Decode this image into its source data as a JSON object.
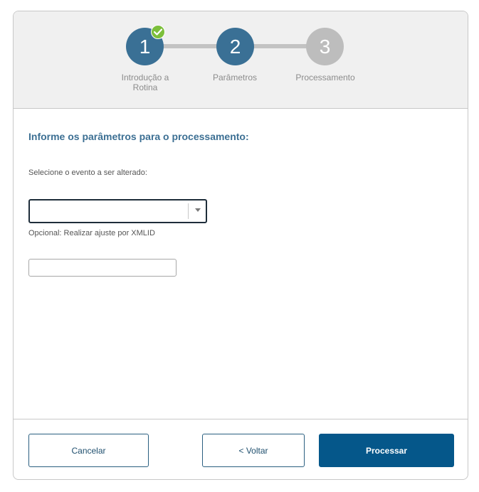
{
  "stepper": {
    "steps": [
      {
        "number": "1",
        "label_line1": "Introdução a",
        "label_line2": "Rotina",
        "status": "done"
      },
      {
        "number": "2",
        "label_line1": "Parâmetros",
        "label_line2": "",
        "status": "active"
      },
      {
        "number": "3",
        "label_line1": "Processamento",
        "label_line2": "",
        "status": "pending"
      }
    ]
  },
  "form": {
    "title": "Informe os parâmetros para o processamento:",
    "event_label": "Selecione o evento a ser alterado:",
    "event_selected_value": "",
    "xmlid_label": "Opcional: Realizar ajuste por XMLID",
    "xmlid_value": "",
    "xmlid_placeholder": ""
  },
  "footer": {
    "cancel_label": "Cancelar",
    "back_label": "< Voltar",
    "process_label": "Processar"
  },
  "colors": {
    "step_active": "#3a7095",
    "step_pending": "#bdbdbd",
    "check_badge": "#7cbf3b",
    "title_blue": "#3c6f93",
    "primary_button": "#05578a"
  },
  "icons": {
    "step_done_badge": "check-icon",
    "select_toggle": "caret-down-icon"
  }
}
